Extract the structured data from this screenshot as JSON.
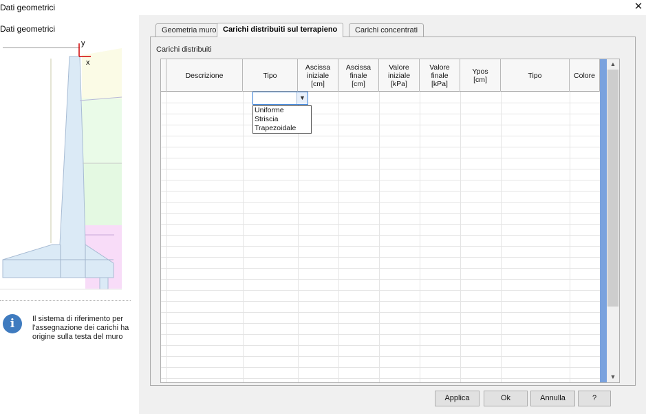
{
  "window": {
    "title": "Dati geometrici",
    "close_glyph": "✕"
  },
  "left_panel": {
    "title": "Dati geometrici",
    "axis_y": "y",
    "axis_x": "x",
    "info_icon": "i",
    "info_text": "Il sistema di riferimento per l'assegnazione dei carichi ha origine sulla testa del muro"
  },
  "tabs": [
    {
      "label": "Geometria muro",
      "active": false
    },
    {
      "label": "Carichi distribuiti sul terrapieno",
      "active": true
    },
    {
      "label": "Carichi concentrati",
      "active": false
    }
  ],
  "section_title": "Carichi distribuiti",
  "table": {
    "columns": [
      "Descrizione",
      "Tipo",
      "Ascissa\niniziale\n[cm]",
      "Ascissa\nfinale\n[cm]",
      "Valore\niniziale\n[kPa]",
      "Valore\nfinale\n[kPa]",
      "Ypos\n[cm]",
      "Tipo",
      "Colore"
    ],
    "rows": []
  },
  "tipo_dropdown": {
    "value": "",
    "options": [
      "Uniforme",
      "Striscia",
      "Trapezoidale"
    ]
  },
  "scroll_icons": {
    "up": "chevron-up-icon",
    "down": "chevron-down-icon"
  },
  "buttons": {
    "apply": "Applica",
    "ok": "Ok",
    "cancel": "Annulla",
    "help": "?"
  },
  "colors": {
    "selection_strip": "#7aa2de",
    "combo_border": "#2f7ad6",
    "info_icon": "#3f7bbf"
  }
}
